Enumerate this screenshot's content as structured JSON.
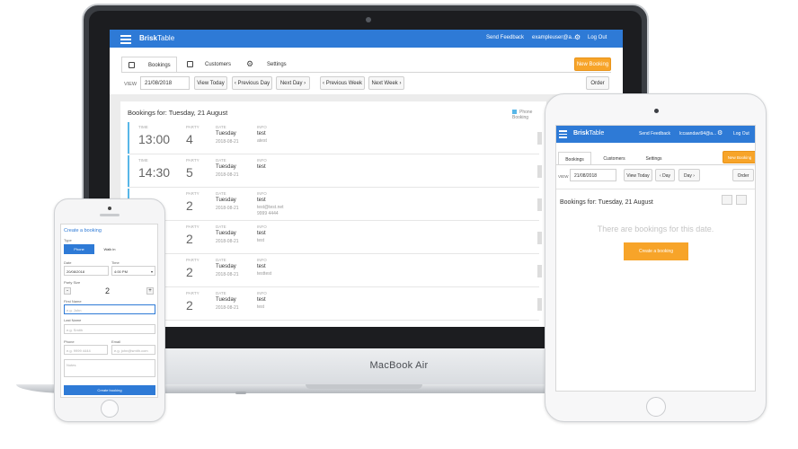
{
  "laptop": {
    "brand": "MacBook Air",
    "app": {
      "logo_bold": "Brisk",
      "logo_light": "Table",
      "send_feedback": "Send Feedback",
      "user": "exampleuser@a...",
      "logout": "Log Out",
      "tabs": [
        "Bookings",
        "Customers",
        "Settings"
      ],
      "new_booking": "New Booking",
      "view_label": "VIEW",
      "view_date": "21/08/2018",
      "view_today": "View Today",
      "prev_day": "Previous Day",
      "next_day": "Next Day",
      "prev_week": "Previous Week",
      "next_week": "Next Week",
      "order": "Order",
      "bookings_title": "Bookings for: Tuesday, 21 August",
      "legend": "Phone Booking",
      "col_labels": {
        "time": "TIME",
        "party": "PARTY",
        "date": "DATE",
        "info": "INFO"
      },
      "rows": [
        {
          "time": "13:00",
          "party": "4",
          "day": "Tuesday",
          "date": "2018-08-21",
          "info": [
            "test",
            "atest",
            ""
          ]
        },
        {
          "time": "14:30",
          "party": "5",
          "day": "Tuesday",
          "date": "2018-08-21",
          "info": [
            "test",
            "",
            ""
          ]
        },
        {
          "time": "",
          "party": "2",
          "day": "Tuesday",
          "date": "2018-08-21",
          "info": [
            "test",
            "test@test.net",
            "9999 4444"
          ]
        },
        {
          "time": "",
          "party": "2",
          "day": "Tuesday",
          "date": "2018-08-21",
          "info": [
            "test",
            "test",
            ""
          ]
        },
        {
          "time": "",
          "party": "2",
          "day": "Tuesday",
          "date": "2018-08-21",
          "info": [
            "test",
            "testtest",
            ""
          ]
        },
        {
          "time": "",
          "party": "2",
          "day": "Tuesday",
          "date": "2018-08-21",
          "info": [
            "test",
            "test",
            ""
          ]
        }
      ]
    }
  },
  "tablet": {
    "logo_bold": "Brisk",
    "logo_light": "Table",
    "send_feedback": "Send Feedback",
    "user": "lccaandavi94@a...",
    "logout": "Log Out",
    "tabs": [
      "Bookings",
      "Customers",
      "Settings"
    ],
    "new_booking": "New Booking",
    "view_label": "VIEW",
    "view_date": "21/08/2018",
    "view_today": "View Today",
    "prev_day": "Day",
    "next_day": "Day",
    "order": "Order",
    "bookings_title": "Bookings for: Tuesday, 21 August",
    "empty": "There are bookings for this date.",
    "create": "Create a booking"
  },
  "phone": {
    "title": "Create a booking",
    "type_label": "Type",
    "type_phone": "Phone",
    "type_walkin": "Walk in",
    "date_label": "Date",
    "date_value": "20/08/2018",
    "time_label": "Time",
    "time_value": "4:00 PM",
    "party_label": "Party Size",
    "party_value": "2",
    "first_label": "First Name",
    "first_ph": "e.g. John",
    "last_label": "Last Name",
    "last_ph": "e.g. Smith",
    "phone_label": "Phone",
    "phone_ph": "e.g. 9999 4444",
    "email_label": "Email",
    "email_ph": "e.g. john@smith.com",
    "notes_ph": "Notes",
    "create_btn": "Create booking"
  },
  "colors": {
    "primary": "#2e7ad6",
    "accent": "#f7a429",
    "phone_booking": "#58b7e8"
  }
}
